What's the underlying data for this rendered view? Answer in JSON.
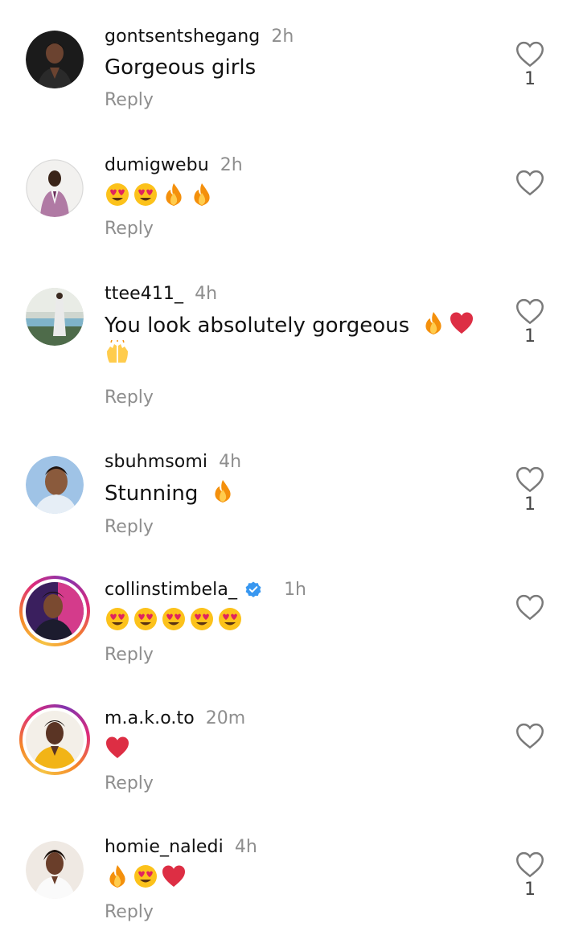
{
  "comments": [
    {
      "username": "gontsentshegang",
      "time": "2h",
      "text": "Gorgeous girls",
      "emojis": [],
      "reply_label": "Reply",
      "likes": "1",
      "verified": false,
      "story_ring": false
    },
    {
      "username": "dumigwebu",
      "time": "2h",
      "text": "",
      "emojis": [
        "heart-eyes",
        "heart-eyes",
        "fire",
        "fire"
      ],
      "reply_label": "Reply",
      "likes": "",
      "verified": false,
      "story_ring": false
    },
    {
      "username": "ttee411_",
      "time": "4h",
      "text": "You look absolutely gorgeous",
      "emojis": [
        "fire",
        "red-heart",
        "raised-hands"
      ],
      "reply_label": "Reply",
      "likes": "1",
      "verified": false,
      "story_ring": false
    },
    {
      "username": "sbuhmsomi",
      "time": "4h",
      "text": "Stunning",
      "emojis": [
        "fire"
      ],
      "reply_label": "Reply",
      "likes": "1",
      "verified": false,
      "story_ring": false
    },
    {
      "username": "collinstimbela_",
      "time": "1h",
      "text": "",
      "emojis": [
        "heart-eyes",
        "heart-eyes",
        "heart-eyes",
        "heart-eyes",
        "heart-eyes"
      ],
      "reply_label": "Reply",
      "likes": "",
      "verified": true,
      "story_ring": true
    },
    {
      "username": "m.a.k.o.to",
      "time": "20m",
      "text": "",
      "emojis": [
        "red-heart"
      ],
      "reply_label": "Reply",
      "likes": "",
      "verified": false,
      "story_ring": true
    },
    {
      "username": "homie_naledi",
      "time": "4h",
      "text": "",
      "emojis": [
        "fire",
        "heart-eyes",
        "red-heart"
      ],
      "reply_label": "Reply",
      "likes": "1",
      "verified": false,
      "story_ring": false
    }
  ],
  "colors": {
    "verified_blue": "#3897f0",
    "meta_gray": "#8e8e8e",
    "story_gradient": [
      "#f6c343",
      "#f58529",
      "#dd2a7b",
      "#8134af"
    ]
  }
}
